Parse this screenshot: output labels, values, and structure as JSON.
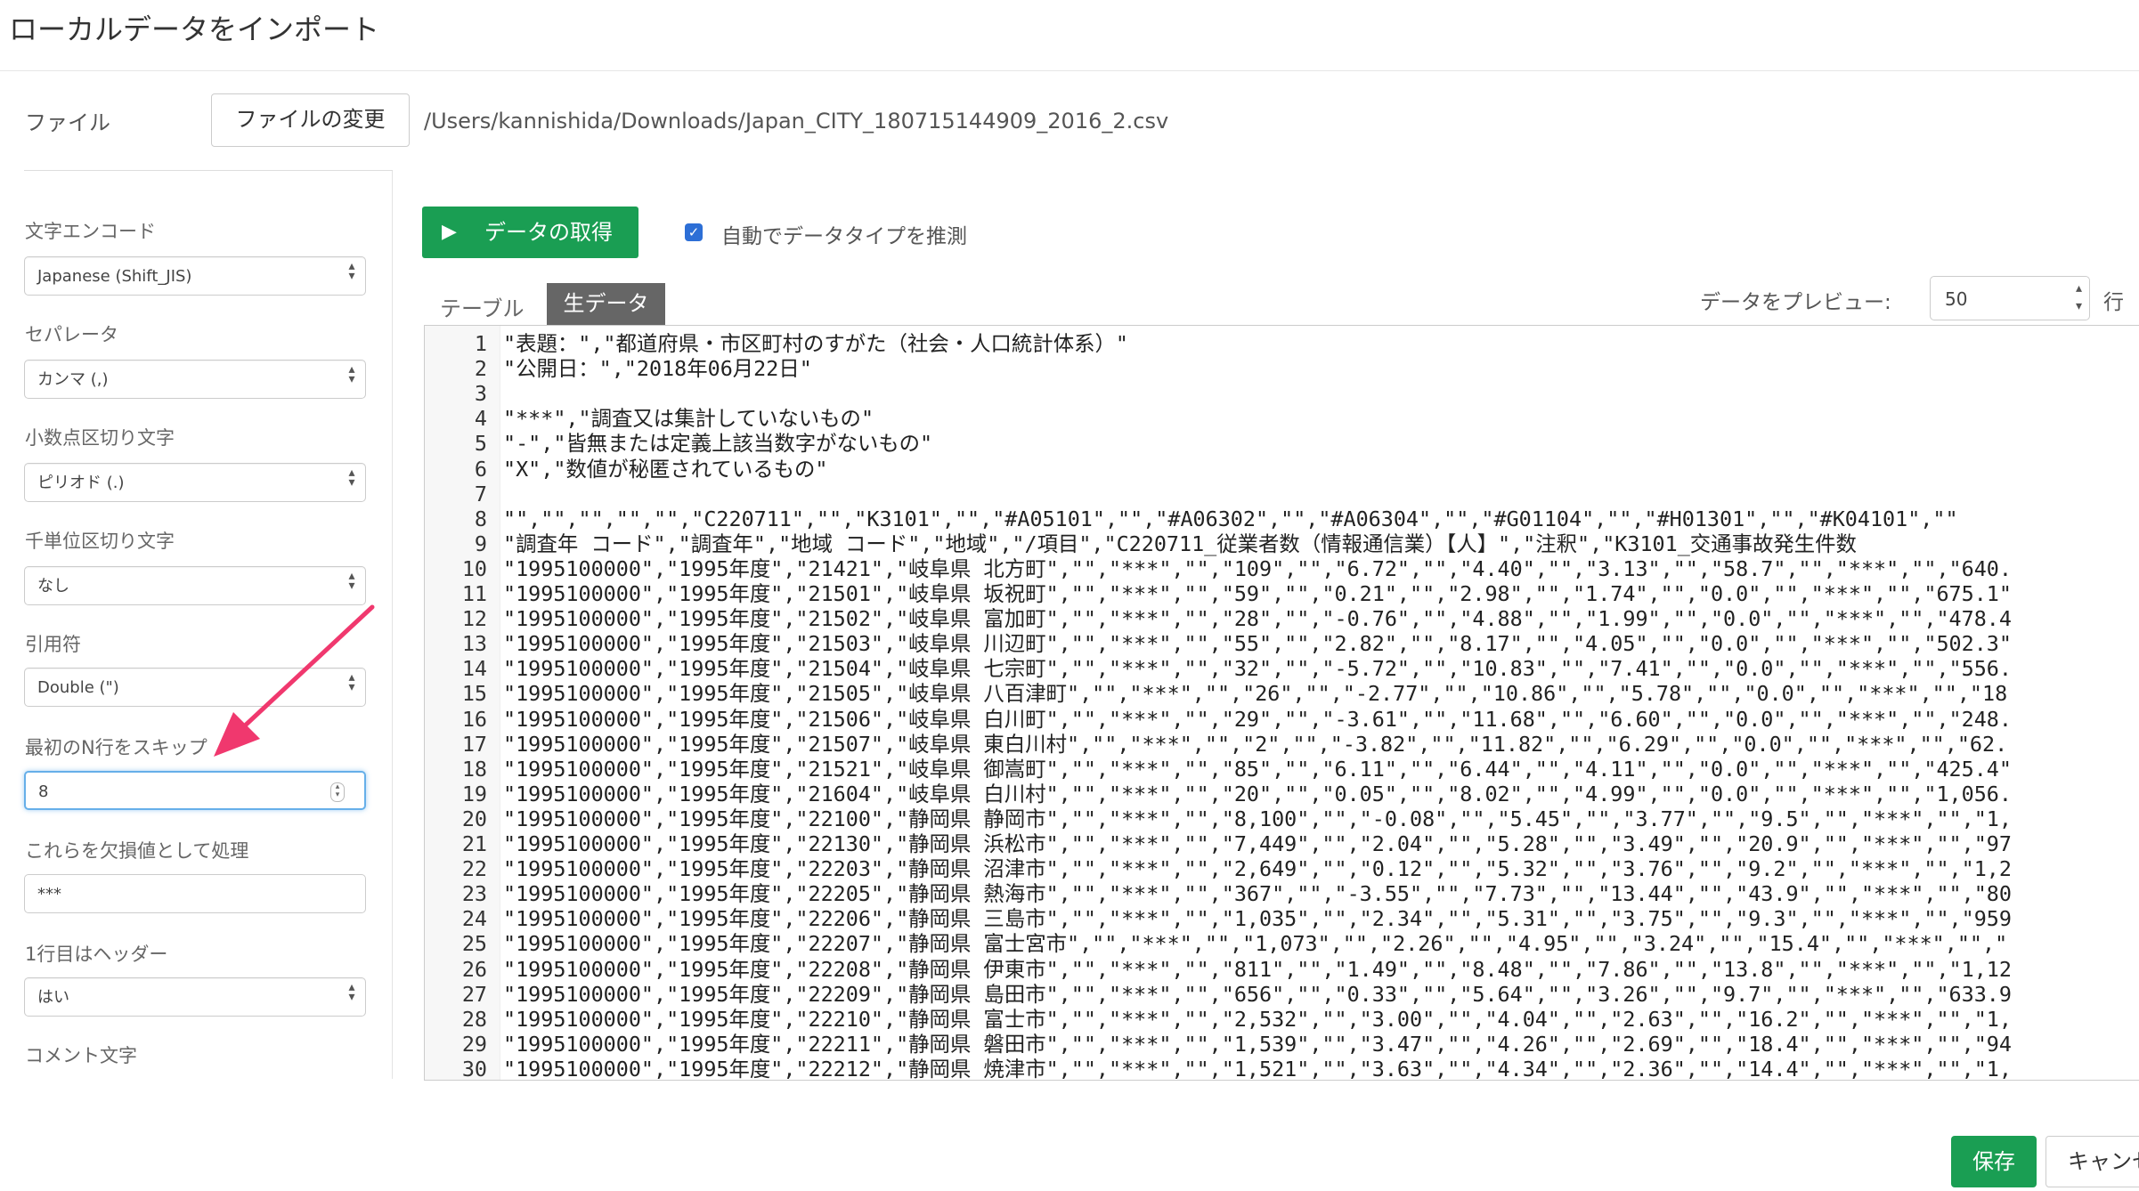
{
  "dialog": {
    "title": "ローカルデータをインポート"
  },
  "file": {
    "label": "ファイル",
    "change_button": "ファイルの変更",
    "path": "/Users/kannishida/Downloads/Japan_CITY_180715144909_2016_2.csv"
  },
  "options": {
    "encoding": {
      "label": "文字エンコード",
      "value": "Japanese (Shift_JIS)"
    },
    "separator": {
      "label": "セパレータ",
      "value": "カンマ (,)"
    },
    "decimal": {
      "label": "小数点区切り文字",
      "value": "ピリオド (.)"
    },
    "thousands": {
      "label": "千単位区切り文字",
      "value": "なし"
    },
    "quote": {
      "label": "引用符",
      "value": "Double (\")"
    },
    "skip_rows": {
      "label": "最初のN行をスキップ",
      "value": "8"
    },
    "na_values": {
      "label": "これらを欠損値として処理",
      "value": "***"
    },
    "header": {
      "label": "1行目はヘッダー",
      "value": "はい"
    },
    "comment": {
      "label": "コメント文字"
    }
  },
  "actions": {
    "get_data": "データの取得",
    "auto_detect_label": "自動でデータタイプを推測",
    "auto_detect_checked": true
  },
  "tabs": {
    "table": "テーブル",
    "raw": "生データ"
  },
  "preview": {
    "label": "データをプレビュー:",
    "value": "50",
    "unit": "行"
  },
  "raw_lines": [
    "\"表題：\",\"都道府県・市区町村のすがた（社会・人口統計体系）\"",
    "\"公開日：\",\"2018年06月22日\"",
    "",
    "\"***\",\"調査又は集計していないもの\"",
    "\"-\",\"皆無または定義上該当数字がないもの\"",
    "\"X\",\"数値が秘匿されているもの\"",
    "",
    "\"\",\"\",\"\",\"\",\"\",\"C220711\",\"\",\"K3101\",\"\",\"#A05101\",\"\",\"#A06302\",\"\",\"#A06304\",\"\",\"#G01104\",\"\",\"#H01301\",\"\",\"#K04101\",\"\"",
    "\"調査年 コード\",\"調査年\",\"地域 コード\",\"地域\",\"/項目\",\"C220711_従業者数（情報通信業）【人】\",\"注釈\",\"K3101_交通事故発生件数",
    "\"1995100000\",\"1995年度\",\"21421\",\"岐阜県 北方町\",\"\",\"***\",\"\",\"109\",\"\",\"6.72\",\"\",\"4.40\",\"\",\"3.13\",\"\",\"58.7\",\"\",\"***\",\"\",\"640.",
    "\"1995100000\",\"1995年度\",\"21501\",\"岐阜県 坂祝町\",\"\",\"***\",\"\",\"59\",\"\",\"0.21\",\"\",\"2.98\",\"\",\"1.74\",\"\",\"0.0\",\"\",\"***\",\"\",\"675.1\"",
    "\"1995100000\",\"1995年度\",\"21502\",\"岐阜県 富加町\",\"\",\"***\",\"\",\"28\",\"\",\"-0.76\",\"\",\"4.88\",\"\",\"1.99\",\"\",\"0.0\",\"\",\"***\",\"\",\"478.4",
    "\"1995100000\",\"1995年度\",\"21503\",\"岐阜県 川辺町\",\"\",\"***\",\"\",\"55\",\"\",\"2.82\",\"\",\"8.17\",\"\",\"4.05\",\"\",\"0.0\",\"\",\"***\",\"\",\"502.3\"",
    "\"1995100000\",\"1995年度\",\"21504\",\"岐阜県 七宗町\",\"\",\"***\",\"\",\"32\",\"\",\"-5.72\",\"\",\"10.83\",\"\",\"7.41\",\"\",\"0.0\",\"\",\"***\",\"\",\"556.",
    "\"1995100000\",\"1995年度\",\"21505\",\"岐阜県 八百津町\",\"\",\"***\",\"\",\"26\",\"\",\"-2.77\",\"\",\"10.86\",\"\",\"5.78\",\"\",\"0.0\",\"\",\"***\",\"\",\"18",
    "\"1995100000\",\"1995年度\",\"21506\",\"岐阜県 白川町\",\"\",\"***\",\"\",\"29\",\"\",\"-3.61\",\"\",\"11.68\",\"\",\"6.60\",\"\",\"0.0\",\"\",\"***\",\"\",\"248.",
    "\"1995100000\",\"1995年度\",\"21507\",\"岐阜県 東白川村\",\"\",\"***\",\"\",\"2\",\"\",\"-3.82\",\"\",\"11.82\",\"\",\"6.29\",\"\",\"0.0\",\"\",\"***\",\"\",\"62.",
    "\"1995100000\",\"1995年度\",\"21521\",\"岐阜県 御嵩町\",\"\",\"***\",\"\",\"85\",\"\",\"6.11\",\"\",\"6.44\",\"\",\"4.11\",\"\",\"0.0\",\"\",\"***\",\"\",\"425.4\"",
    "\"1995100000\",\"1995年度\",\"21604\",\"岐阜県 白川村\",\"\",\"***\",\"\",\"20\",\"\",\"0.05\",\"\",\"8.02\",\"\",\"4.99\",\"\",\"0.0\",\"\",\"***\",\"\",\"1,056.",
    "\"1995100000\",\"1995年度\",\"22100\",\"静岡県 静岡市\",\"\",\"***\",\"\",\"8,100\",\"\",\"-0.08\",\"\",\"5.45\",\"\",\"3.77\",\"\",\"9.5\",\"\",\"***\",\"\",\"1,",
    "\"1995100000\",\"1995年度\",\"22130\",\"静岡県 浜松市\",\"\",\"***\",\"\",\"7,449\",\"\",\"2.04\",\"\",\"5.28\",\"\",\"3.49\",\"\",\"20.9\",\"\",\"***\",\"\",\"97",
    "\"1995100000\",\"1995年度\",\"22203\",\"静岡県 沼津市\",\"\",\"***\",\"\",\"2,649\",\"\",\"0.12\",\"\",\"5.32\",\"\",\"3.76\",\"\",\"9.2\",\"\",\"***\",\"\",\"1,2",
    "\"1995100000\",\"1995年度\",\"22205\",\"静岡県 熱海市\",\"\",\"***\",\"\",\"367\",\"\",\"-3.55\",\"\",\"7.73\",\"\",\"13.44\",\"\",\"43.9\",\"\",\"***\",\"\",\"80",
    "\"1995100000\",\"1995年度\",\"22206\",\"静岡県 三島市\",\"\",\"***\",\"\",\"1,035\",\"\",\"2.34\",\"\",\"5.31\",\"\",\"3.75\",\"\",\"9.3\",\"\",\"***\",\"\",\"959",
    "\"1995100000\",\"1995年度\",\"22207\",\"静岡県 富士宮市\",\"\",\"***\",\"\",\"1,073\",\"\",\"2.26\",\"\",\"4.95\",\"\",\"3.24\",\"\",\"15.4\",\"\",\"***\",\"\",\"",
    "\"1995100000\",\"1995年度\",\"22208\",\"静岡県 伊東市\",\"\",\"***\",\"\",\"811\",\"\",\"1.49\",\"\",\"8.48\",\"\",\"7.86\",\"\",\"13.8\",\"\",\"***\",\"\",\"1,12",
    "\"1995100000\",\"1995年度\",\"22209\",\"静岡県 島田市\",\"\",\"***\",\"\",\"656\",\"\",\"0.33\",\"\",\"5.64\",\"\",\"3.26\",\"\",\"9.7\",\"\",\"***\",\"\",\"633.9",
    "\"1995100000\",\"1995年度\",\"22210\",\"静岡県 富士市\",\"\",\"***\",\"\",\"2,532\",\"\",\"3.00\",\"\",\"4.04\",\"\",\"2.63\",\"\",\"16.2\",\"\",\"***\",\"\",\"1,",
    "\"1995100000\",\"1995年度\",\"22211\",\"静岡県 磐田市\",\"\",\"***\",\"\",\"1,539\",\"\",\"3.47\",\"\",\"4.26\",\"\",\"2.69\",\"\",\"18.4\",\"\",\"***\",\"\",\"94",
    "\"1995100000\",\"1995年度\",\"22212\",\"静岡県 焼津市\",\"\",\"***\",\"\",\"1,521\",\"\",\"3.63\",\"\",\"4.34\",\"\",\"2.36\",\"\",\"14.4\",\"\",\"***\",\"\",\"1,"
  ],
  "footer": {
    "save": "保存",
    "cancel": "キャンセル"
  },
  "colors": {
    "primary": "#1a9e53",
    "arrow": "#f0386e",
    "checkbox": "#2d6fd6",
    "focus": "#66afe9"
  }
}
